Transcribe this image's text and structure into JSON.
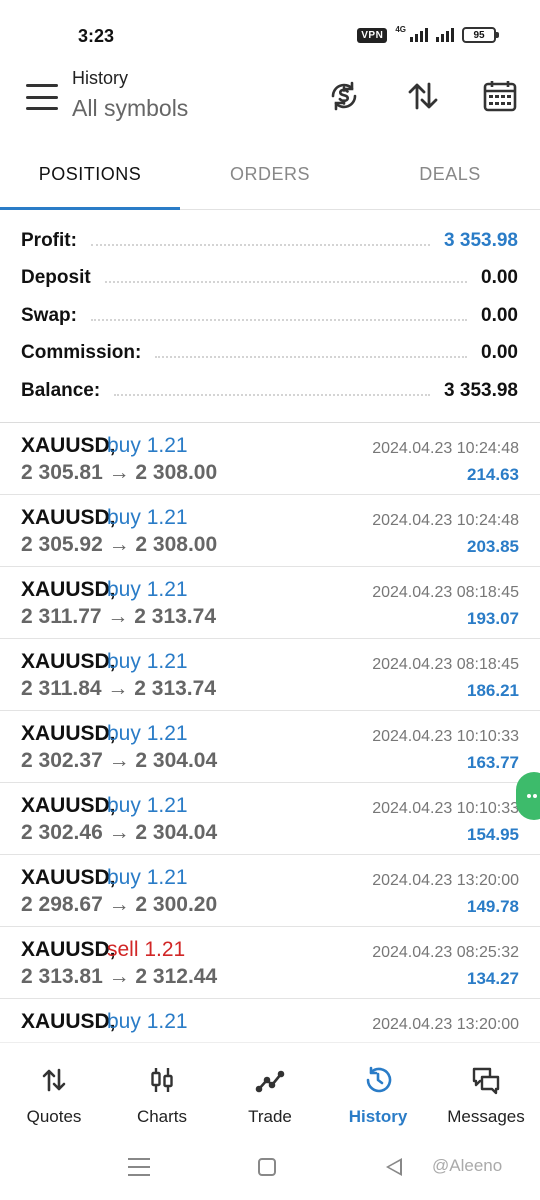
{
  "status_bar": {
    "time": "3:23",
    "vpn": "VPN",
    "network": "4G",
    "battery": "95"
  },
  "header": {
    "title": "History",
    "subtitle": "All symbols",
    "icons": [
      "currency-exchange-icon",
      "sort-icon",
      "calendar-icon"
    ]
  },
  "tabs": [
    {
      "label": "POSITIONS",
      "active": true
    },
    {
      "label": "ORDERS",
      "active": false
    },
    {
      "label": "DEALS",
      "active": false
    }
  ],
  "summary": {
    "profit": {
      "label": "Profit:",
      "value": "3 353.98"
    },
    "deposit": {
      "label": "Deposit",
      "value": "0.00"
    },
    "swap": {
      "label": "Swap:",
      "value": "0.00"
    },
    "commission": {
      "label": "Commission:",
      "value": "0.00"
    },
    "balance": {
      "label": "Balance:",
      "value": "3 353.98"
    }
  },
  "deals": [
    {
      "symbol": "XAUUSD,",
      "type": "buy 1.21",
      "side": "buy",
      "prices": "2 305.81 → 2 308.00",
      "time": "2024.04.23 10:24:48",
      "profit": "214.63"
    },
    {
      "symbol": "XAUUSD,",
      "type": "buy 1.21",
      "side": "buy",
      "prices": "2 305.92 → 2 308.00",
      "time": "2024.04.23 10:24:48",
      "profit": "203.85"
    },
    {
      "symbol": "XAUUSD,",
      "type": "buy 1.21",
      "side": "buy",
      "prices": "2 311.77 → 2 313.74",
      "time": "2024.04.23 08:18:45",
      "profit": "193.07"
    },
    {
      "symbol": "XAUUSD,",
      "type": "buy 1.21",
      "side": "buy",
      "prices": "2 311.84 → 2 313.74",
      "time": "2024.04.23 08:18:45",
      "profit": "186.21"
    },
    {
      "symbol": "XAUUSD,",
      "type": "buy 1.21",
      "side": "buy",
      "prices": "2 302.37 → 2 304.04",
      "time": "2024.04.23 10:10:33",
      "profit": "163.77"
    },
    {
      "symbol": "XAUUSD,",
      "type": "buy 1.21",
      "side": "buy",
      "prices": "2 302.46 → 2 304.04",
      "time": "2024.04.23 10:10:33",
      "profit": "154.95"
    },
    {
      "symbol": "XAUUSD,",
      "type": "buy 1.21",
      "side": "buy",
      "prices": "2 298.67 → 2 300.20",
      "time": "2024.04.23 13:20:00",
      "profit": "149.78"
    },
    {
      "symbol": "XAUUSD,",
      "type": "sell 1.21",
      "side": "sell",
      "prices": "2 313.81 → 2 312.44",
      "time": "2024.04.23 08:25:32",
      "profit": "134.27"
    },
    {
      "symbol": "XAUUSD,",
      "type": "buy 1.21",
      "side": "buy",
      "prices": "",
      "time": "2024.04.23 13:20:00",
      "profit": ""
    }
  ],
  "bottom_nav": [
    {
      "label": "Quotes",
      "icon": "quotes-icon",
      "active": false
    },
    {
      "label": "Charts",
      "icon": "candlestick-icon",
      "active": false
    },
    {
      "label": "Trade",
      "icon": "trade-icon",
      "active": false
    },
    {
      "label": "History",
      "icon": "history-icon",
      "active": true
    },
    {
      "label": "Messages",
      "icon": "messages-icon",
      "active": false
    }
  ],
  "watermark": "@Aleeno",
  "colors": {
    "accent": "#2a7cc7",
    "sell": "#d12626",
    "float_handle": "#3dbb6b"
  }
}
